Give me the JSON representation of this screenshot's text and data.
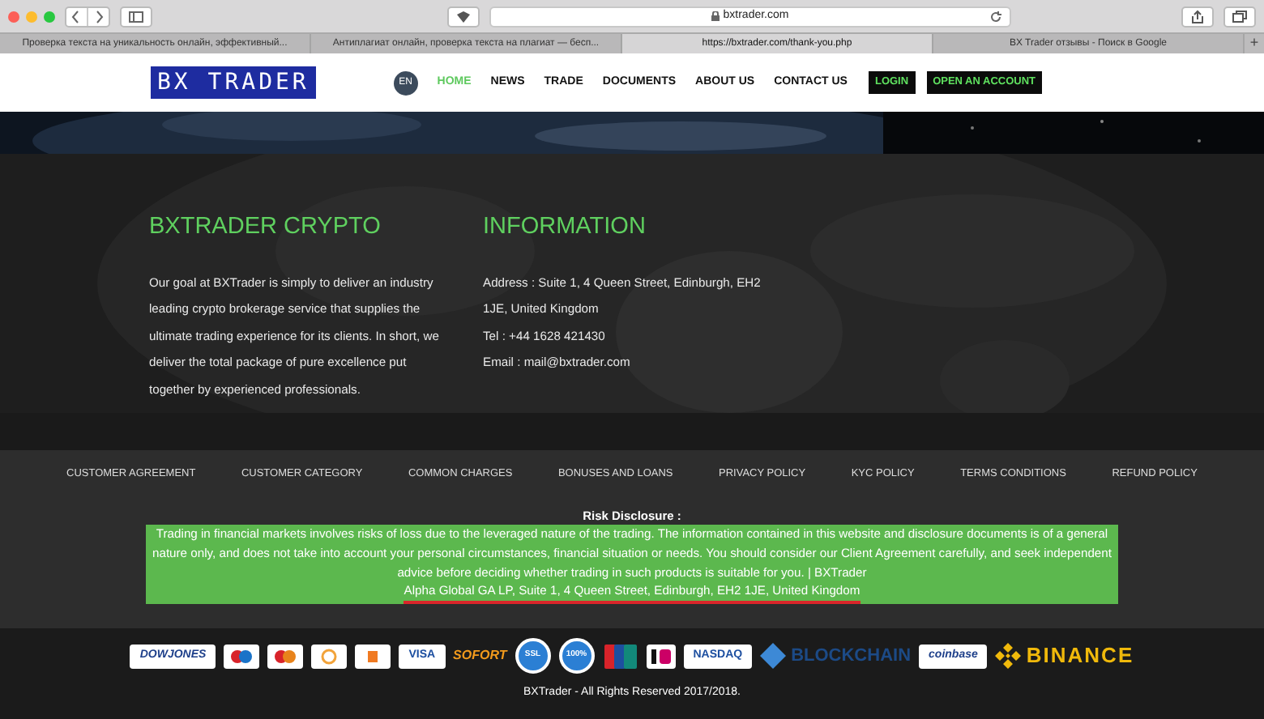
{
  "browser": {
    "address": "bxtrader.com",
    "tabs": [
      {
        "label": "Проверка текста на уникальность онлайн, эффективный...",
        "selected": false
      },
      {
        "label": "Антиплагиат онлайн, проверка текста на плагиат — бесп...",
        "selected": false
      },
      {
        "label": "https://bxtrader.com/thank-you.php",
        "selected": true
      },
      {
        "label": "BX Trader отзывы - Поиск в Google",
        "selected": false
      }
    ],
    "new_tab": "+"
  },
  "site": {
    "logo": "BX TRADER",
    "language": "EN",
    "nav": [
      {
        "label": "HOME",
        "selected": true
      },
      {
        "label": "NEWS",
        "selected": false
      },
      {
        "label": "TRADE",
        "selected": false
      },
      {
        "label": "DOCUMENTS",
        "selected": false
      },
      {
        "label": "ABOUT US",
        "selected": false
      },
      {
        "label": "CONTACT US",
        "selected": false
      }
    ],
    "buttons": [
      "LOGIN",
      "OPEN AN ACCOUNT"
    ]
  },
  "about": {
    "title": "BXTRADER CRYPTO",
    "text": "Our goal at BXTrader is simply to deliver an industry leading crypto brokerage service that supplies the ultimate trading experience for its clients. In short, we deliver the total package of pure excellence put together by experienced professionals."
  },
  "information": {
    "title": "INFORMATION",
    "lines": [
      "Address : Suite 1, 4 Queen Street, Edinburgh, EH2 1JE, United Kingdom",
      "Tel : +44 1628 421430",
      "Email : mail@bxtrader.com"
    ]
  },
  "footer_links": [
    "CUSTOMER AGREEMENT",
    "CUSTOMER CATEGORY",
    "COMMON CHARGES",
    "BONUSES AND LOANS",
    "PRIVACY POLICY",
    "KYC POLICY",
    "TERMS CONDITIONS",
    "REFUND POLICY"
  ],
  "risk": {
    "title": "Risk Disclosure :",
    "text": "Trading in financial markets involves risks of loss due to the leveraged nature of the trading. The information contained in this website and disclosure documents is of a general nature only, and does not take into account your personal circumstances, financial situation or needs. You should consider our Client Agreement carefully, and seek independent advice before deciding whether trading in such products is suitable for you. | BXTrader",
    "address": "Alpha Global GA LP, Suite 1, 4 Queen Street, Edinburgh, EH2 1JE, United Kingdom",
    "underlined": true
  },
  "logos": [
    {
      "kind": "badge",
      "label": "DOWJONES"
    },
    {
      "kind": "maestro"
    },
    {
      "kind": "mastercard"
    },
    {
      "kind": "ring"
    },
    {
      "kind": "block"
    },
    {
      "kind": "badge",
      "label": "VISA"
    },
    {
      "kind": "script",
      "label": "SOFORT"
    },
    {
      "kind": "seal",
      "label": "SSL"
    },
    {
      "kind": "seal",
      "label": "100%"
    },
    {
      "kind": "card"
    },
    {
      "kind": "ideal"
    },
    {
      "kind": "badge",
      "label": "NASDAQ"
    },
    {
      "kind": "brand",
      "label": "BLOCKCHAIN"
    },
    {
      "kind": "badge",
      "label": "coinbase"
    },
    {
      "kind": "binance",
      "label": "BINANCE"
    }
  ],
  "copyright": "BXTrader - All Rights Reserved 2017/2018."
}
